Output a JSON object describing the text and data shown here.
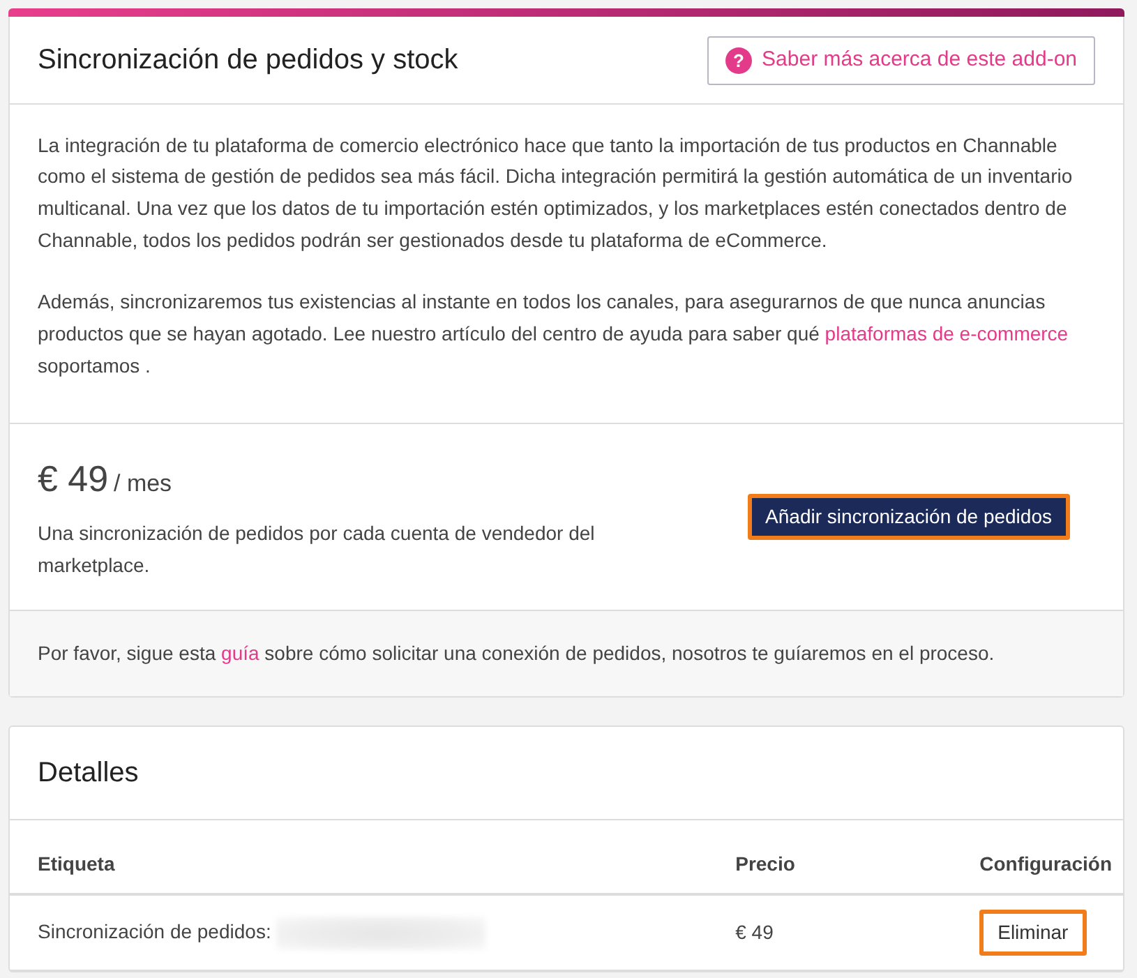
{
  "addon_card": {
    "title": "Sincronización de pedidos y stock",
    "help_button": {
      "label": "Saber más acerca de este add-on",
      "icon": "?"
    },
    "paragraphs": [
      "La integración de tu plataforma de comercio electrónico hace que tanto la importación de tus productos en Channable como el sistema de gestión de pedidos sea más fácil. Dicha integración permitirá la gestión automática de un inventario multicanal. Una vez que los datos de tu importación estén optimizados, y los marketplaces estén conectados dentro de Channable, todos los pedidos podrán ser gestionados desde tu plataforma de eCommerce.",
      {
        "before": "Además, sincronizaremos tus existencias al instante en todos los canales, para asegurarnos de que nunca anuncias productos que se hayan agotado. Lee nuestro artículo del centro de ayuda para saber qué ",
        "link": "plataformas de e-commerce",
        "after": " soportamos ."
      }
    ],
    "price": "€ 49",
    "period": "/ mes",
    "price_note": "Una sincronización de pedidos por cada cuenta de vendedor del marketplace.",
    "add_button": {
      "label": "Añadir sincronización de pedidos",
      "highlighted": true
    },
    "footer": {
      "before": "Por favor, sigue esta ",
      "link": "guía",
      "after": " sobre cómo solicitar una conexión de pedidos, nosotros te guíaremos en el proceso."
    }
  },
  "details_card": {
    "title": "Detalles",
    "columns": [
      "Etiqueta",
      "Precio",
      "Configuración"
    ],
    "rows": [
      {
        "label": "Sincronización de pedidos:",
        "redacted": true,
        "price": "€ 49",
        "action": {
          "label": "Eliminar",
          "highlighted": true
        }
      }
    ]
  }
}
